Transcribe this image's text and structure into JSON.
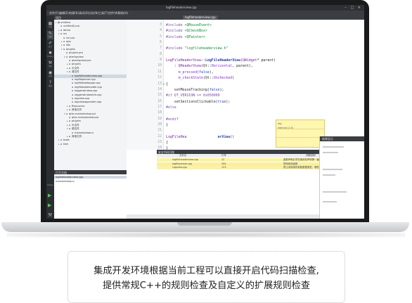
{
  "window": {
    "title": "logfileheaderview.cpp",
    "controls": "– □ ×"
  },
  "menu": [
    "文件(F)",
    "编辑(E)",
    "构建(B)",
    "调试(D)",
    "分析(N)",
    "工具(T)",
    "控件(W)",
    "帮助(H)"
  ],
  "modes": [
    {
      "icon": "grid-icon",
      "glyph": "▦",
      "label": "欢迎"
    },
    {
      "icon": "edit-icon",
      "glyph": "✎",
      "label": "编辑"
    },
    {
      "icon": "design-icon",
      "glyph": "✐",
      "label": "设计"
    },
    {
      "icon": "debug-icon",
      "glyph": "✹",
      "label": "Debug"
    },
    {
      "icon": "project-icon",
      "glyph": "⚒",
      "label": "项目"
    },
    {
      "icon": "analyze-icon",
      "glyph": "◉",
      "label": "分析"
    },
    {
      "icon": "help-icon",
      "glyph": "?",
      "label": "帮助"
    }
  ],
  "project_panel": {
    "header": "项目",
    "tree": [
      {
        "indent": 0,
        "twisty": "▾",
        "icon": "▣",
        "label": "untitled"
      },
      {
        "indent": 1,
        "twisty": "",
        "icon": "▪",
        "label": "untitled2.pro"
      },
      {
        "indent": 1,
        "twisty": "▸",
        "icon": "▪",
        "label": "demo"
      },
      {
        "indent": 1,
        "twisty": "▾",
        "icon": "▪",
        "label": "src"
      },
      {
        "indent": 2,
        "twisty": "",
        "icon": "▪",
        "label": "src.pro"
      },
      {
        "indent": 2,
        "twisty": "▸",
        "icon": "▪",
        "label": "app"
      },
      {
        "indent": 2,
        "twisty": "▸",
        "icon": "▪",
        "label": "libs"
      },
      {
        "indent": 2,
        "twisty": "▾",
        "icon": "▪",
        "label": "plugins"
      },
      {
        "indent": 3,
        "twisty": "",
        "icon": "▪",
        "label": "plugins.pro"
      },
      {
        "indent": 3,
        "twisty": "▾",
        "icon": "▪",
        "label": "qtechgview"
      },
      {
        "indent": 4,
        "twisty": "",
        "icon": "▪",
        "label": "qtechgview.pro"
      },
      {
        "indent": 4,
        "twisty": "▸",
        "icon": "▪",
        "label": "plugins"
      },
      {
        "indent": 4,
        "twisty": "▸",
        "icon": "▪",
        "label": "头文件"
      },
      {
        "indent": 4,
        "twisty": "▾",
        "icon": "▪",
        "label": "源文件"
      },
      {
        "indent": 5,
        "twisty": "",
        "icon": "▪",
        "label": "logfileheaderview.cpp"
      },
      {
        "indent": 5,
        "twisty": "",
        "icon": "▪",
        "label": "logfileparser.cpp"
      },
      {
        "indent": 5,
        "twisty": "",
        "icon": "▪",
        "label": "logfiletablepage.cpp"
      },
      {
        "indent": 5,
        "twisty": "",
        "icon": "▪",
        "label": "logfiletablemodel.cpp"
      },
      {
        "indent": 5,
        "twisty": "",
        "icon": "▪",
        "label": "loggerwindow.cpp"
      },
      {
        "indent": 5,
        "twisty": "",
        "icon": "▪",
        "label": "loggerwindowhdr.cpp"
      },
      {
        "indent": 5,
        "twisty": "",
        "icon": "▪",
        "label": "logview.cpp"
      },
      {
        "indent": 5,
        "twisty": "",
        "icon": "▪",
        "label": "logviewappender.cpp"
      },
      {
        "indent": 4,
        "twisty": "▸",
        "icon": "▪",
        "label": "Resources"
      },
      {
        "indent": 4,
        "twisty": "▸",
        "icon": "▪",
        "label": "其他文件"
      },
      {
        "indent": 3,
        "twisty": "▾",
        "icon": "▪",
        "label": "qtec.mainwindow.pui"
      },
      {
        "indent": 4,
        "twisty": "",
        "icon": "▪",
        "label": "qtec.mainwindow.pro"
      },
      {
        "indent": 4,
        "twisty": "▸",
        "icon": "▪",
        "label": "plugins"
      },
      {
        "indent": 4,
        "twisty": "▸",
        "icon": "▪",
        "label": "头文件"
      },
      {
        "indent": 4,
        "twisty": "▾",
        "icon": "▪",
        "label": "源文件"
      },
      {
        "indent": 5,
        "twisty": "",
        "icon": "▪",
        "label": "mainwindow.cc"
      },
      {
        "indent": 4,
        "twisty": "▸",
        "icon": "▪",
        "label": "其他文件"
      },
      {
        "indent": 1,
        "twisty": "▸",
        "icon": "▪",
        "label": "tools"
      },
      {
        "indent": 1,
        "twisty": "▸",
        "icon": "▪",
        "label": "test"
      }
    ]
  },
  "open_docs": {
    "header": "打开文档",
    "items": [
      "logfileheaderview.cpp",
      "mainwindow.cc"
    ]
  },
  "run_controls": {
    "device_label": "Debug",
    "run": "▶",
    "debug_run": "▶",
    "build": "⚒"
  },
  "editor": {
    "lines": [
      {
        "n": 3,
        "segs": [
          [
            "pp",
            "#include "
          ],
          [
            "str",
            "<QMouseEvent>"
          ]
        ]
      },
      {
        "n": 4,
        "segs": [
          [
            "pp",
            "#include "
          ],
          [
            "str",
            "<QCheckBox>"
          ]
        ]
      },
      {
        "n": 5,
        "segs": [
          [
            "pp",
            "#include "
          ],
          [
            "str",
            "<QPainter>"
          ]
        ]
      },
      {
        "n": 6,
        "segs": []
      },
      {
        "n": 7,
        "segs": [
          [
            "pp",
            "#include "
          ],
          [
            "str",
            "\"logfileheaderview.h\""
          ]
        ]
      },
      {
        "n": 8,
        "segs": []
      },
      {
        "n": 9,
        "segs": [
          [
            "cls",
            "LogFileHeaderView"
          ],
          [
            "",
            "::"
          ],
          [
            "fn",
            "LogFileHeaderView"
          ],
          [
            "",
            "("
          ],
          [
            "cls",
            "QWidget"
          ],
          [
            "",
            "* parent)"
          ]
        ]
      },
      {
        "n": 10,
        "segs": [
          [
            "",
            "    : "
          ],
          [
            "cls",
            "QHeaderView"
          ],
          [
            "",
            "(Qt::"
          ],
          [
            "enm",
            "Horizontal"
          ],
          [
            "",
            ", parent),"
          ]
        ]
      },
      {
        "n": 11,
        "segs": [
          [
            "",
            "      "
          ],
          [
            "enm",
            "m_pressed"
          ],
          [
            "",
            "("
          ],
          [
            "kw",
            "false"
          ],
          [
            "",
            "),"
          ]
        ]
      },
      {
        "n": 12,
        "segs": [
          [
            "",
            "      "
          ],
          [
            "enm",
            "m_checkState"
          ],
          [
            "",
            "(Qt::"
          ],
          [
            "enm",
            "Unchecked"
          ],
          [
            "",
            ")"
          ]
        ]
      },
      {
        "n": 13,
        "fold": "▾",
        "segs": [
          [
            "",
            "{"
          ]
        ]
      },
      {
        "n": 14,
        "segs": [
          [
            "",
            "    setMouseTracking("
          ],
          [
            "kw",
            "false"
          ],
          [
            "",
            ");"
          ]
        ]
      },
      {
        "n": 15,
        "segs": [
          [
            "pp",
            "#if QT_VERSION >= 0x050000"
          ]
        ]
      },
      {
        "n": 16,
        "segs": [
          [
            "",
            "    setSectionsClickable("
          ],
          [
            "kw",
            "true"
          ],
          [
            "",
            ");"
          ]
        ]
      },
      {
        "n": 17,
        "segs": [
          [
            "pp",
            "#else"
          ]
        ]
      },
      {
        "n": 18,
        "segs": []
      },
      {
        "n": 19,
        "segs": [
          [
            "pp",
            "#endif"
          ]
        ]
      },
      {
        "n": 20,
        "segs": [
          [
            "",
            "}"
          ]
        ]
      },
      {
        "n": 21,
        "segs": []
      },
      {
        "n": 22,
        "segs": [
          [
            "cls",
            "LogFileHea"
          ],
          [
            "",
            "               "
          ],
          [
            "fn",
            "erView"
          ],
          [
            "",
            "()"
          ]
        ]
      },
      {
        "n": 23,
        "segs": [
          [
            "",
            "{"
          ]
        ]
      },
      {
        "n": 24,
        "segs": [
          [
            "",
            "}"
          ]
        ]
      }
    ],
    "tooltip": [
      "key",
      "interval (1:3)"
    ]
  },
  "results": {
    "header": "安全代码扫描",
    "columns": [
      "文件名",
      "行号",
      "问题说明"
    ],
    "rows": [
      [
        "logfileheaderview.cpp",
        "22",
        "函数声明必须在使用前声明第一遍"
      ],
      [
        "logfileparser.cpp",
        "344",
        "禁用危险函数"
      ],
      [
        "Logview.cpp",
        "123",
        "禁止未使用的参数数据类型，哪些不符合goto"
      ]
    ]
  },
  "side_panel": {
    "header": "结果显示"
  },
  "caption": {
    "line1": "集成开发环境根据当前工程可以直接开启代码扫描检查,",
    "line2": "提供常规C++的规则检查及自定义的扩展规则检查"
  },
  "colors": {
    "accent": "#59c35a",
    "highlight": "#fbf3a3",
    "dark_chrome": "#2e3134"
  }
}
